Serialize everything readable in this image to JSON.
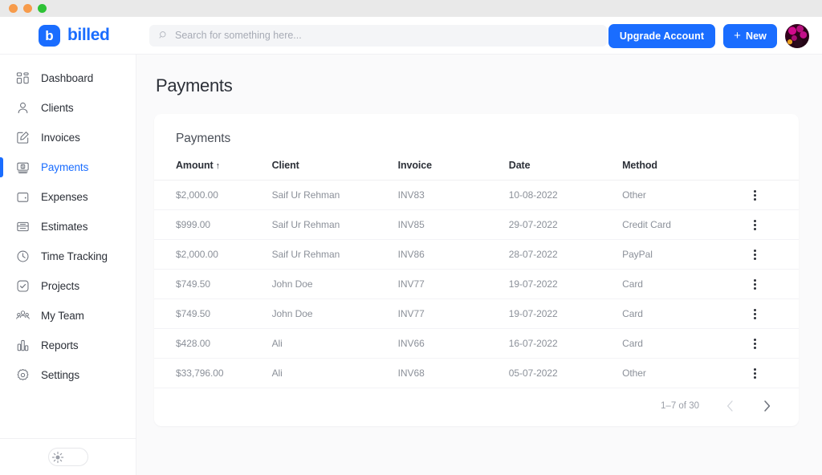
{
  "window": {
    "traffic_lights": [
      "orange",
      "orange",
      "green"
    ]
  },
  "header": {
    "brand_mark": "b",
    "brand_name": "billed",
    "search": {
      "placeholder": "Search for something here...",
      "value": ""
    },
    "upgrade_label": "Upgrade Account",
    "new_label": "New",
    "new_plus": "+"
  },
  "sidebar": {
    "items": [
      {
        "label": "Dashboard",
        "icon": "dashboard-icon",
        "active": false
      },
      {
        "label": "Clients",
        "icon": "user-icon",
        "active": false
      },
      {
        "label": "Invoices",
        "icon": "edit-document-icon",
        "active": false
      },
      {
        "label": "Payments",
        "icon": "banknote-icon",
        "active": true
      },
      {
        "label": "Expenses",
        "icon": "wallet-icon",
        "active": false
      },
      {
        "label": "Estimates",
        "icon": "inbox-icon",
        "active": false
      },
      {
        "label": "Time Tracking",
        "icon": "clock-icon",
        "active": false
      },
      {
        "label": "Projects",
        "icon": "check-square-icon",
        "active": false
      },
      {
        "label": "My Team",
        "icon": "people-icon",
        "active": false
      },
      {
        "label": "Reports",
        "icon": "bar-chart-icon",
        "active": false
      },
      {
        "label": "Settings",
        "icon": "gear-icon",
        "active": false
      }
    ],
    "theme_toggle": {
      "icon": "sun-icon",
      "state": "light"
    }
  },
  "main": {
    "page_title": "Payments",
    "card_title": "Payments",
    "table": {
      "columns": [
        "Amount",
        "Client",
        "Invoice",
        "Date",
        "Method"
      ],
      "sorted_column": "Amount",
      "sort_direction": "ascending",
      "sort_glyph": "↑",
      "rows": [
        {
          "amount": "$2,000.00",
          "client": "Saif Ur Rehman",
          "invoice": "INV83",
          "date": "10-08-2022",
          "method": "Other"
        },
        {
          "amount": "$999.00",
          "client": "Saif Ur Rehman",
          "invoice": "INV85",
          "date": "29-07-2022",
          "method": "Credit Card"
        },
        {
          "amount": "$2,000.00",
          "client": "Saif Ur Rehman",
          "invoice": "INV86",
          "date": "28-07-2022",
          "method": "PayPal"
        },
        {
          "amount": "$749.50",
          "client": "John Doe",
          "invoice": "INV77",
          "date": "19-07-2022",
          "method": "Card"
        },
        {
          "amount": "$749.50",
          "client": "John Doe",
          "invoice": "INV77",
          "date": "19-07-2022",
          "method": "Card"
        },
        {
          "amount": "$428.00",
          "client": "Ali",
          "invoice": "INV66",
          "date": "16-07-2022",
          "method": "Card"
        },
        {
          "amount": "$33,796.00",
          "client": "Ali",
          "invoice": "INV68",
          "date": "05-07-2022",
          "method": "Other"
        }
      ]
    },
    "pagination": {
      "range_label": "1–7 of 30",
      "prev_enabled": false,
      "next_enabled": true
    }
  },
  "colors": {
    "accent": "#1a6dff",
    "page_bg": "#fafafb",
    "card_bg": "#ffffff",
    "text_primary": "#2c3038",
    "text_muted": "#8b9099"
  }
}
